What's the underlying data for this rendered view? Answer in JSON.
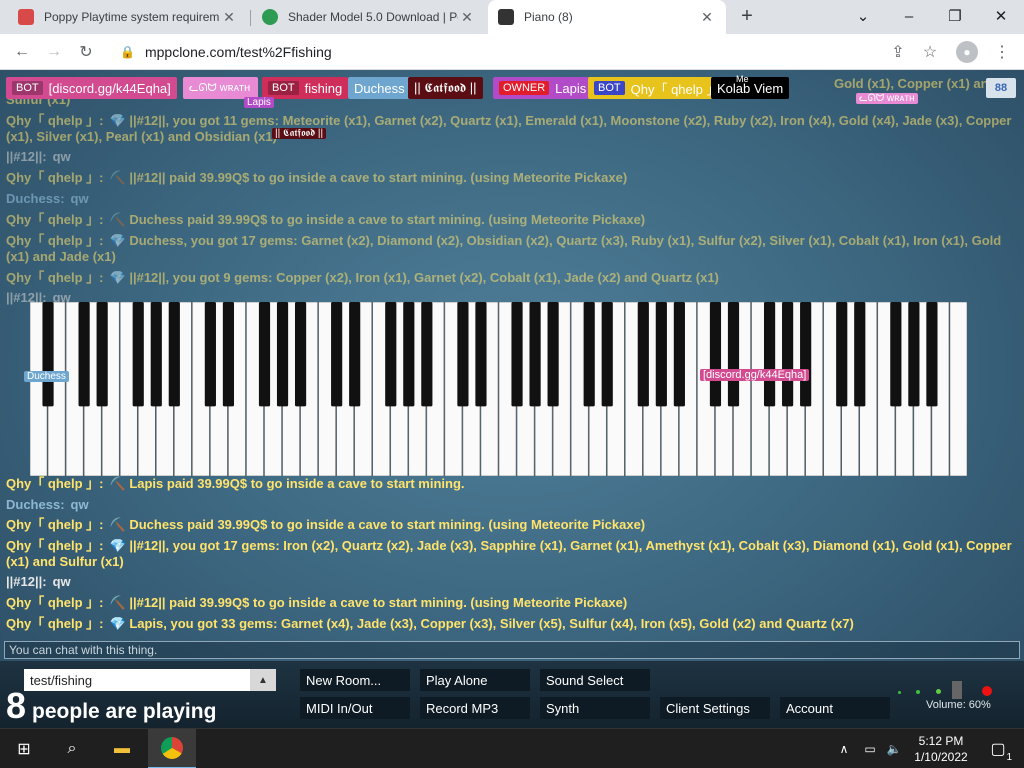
{
  "browser": {
    "tabs": [
      {
        "title": "Poppy Playtime system requirem",
        "icon": "poppy-favicon"
      },
      {
        "title": "Shader Model 5.0 Download | Pe",
        "icon": "shader-favicon"
      },
      {
        "title": "Piano (8)",
        "icon": "piano-favicon"
      }
    ],
    "url": "mppclone.com/test%2Ffishing"
  },
  "users": {
    "u1_badge": "BOT",
    "u1_name": "[discord.gg/k44Eqha]",
    "u2_name": "ᓚᘏᗢ ᴡʀᴀᴛʜ",
    "u2_cursor": "Lapis",
    "u3_badge": "BOT",
    "u3_name": "fishing",
    "u4_name": "Duchess",
    "u5_name": "|| 𝕮𝖆𝖙𝖋𝖔𝖔𝖉 ||",
    "u6_badge": "OWNER",
    "u6_name": "Lapis",
    "u7_badge": "BOT",
    "u7_name": "Qhy「 qhelp 」",
    "u8_name": "Kolab Viem",
    "u8_me": "Me",
    "cursor_wrath": "ᓚᘏᗢ ᴡʀᴀᴛʜ",
    "cursor_catfood": "|| 𝕮𝖆𝖙𝖋𝖔𝖔𝖉 ||",
    "cursor_duchess": "Duchess",
    "cursor_discord": "[discord.gg/k44Eqha]",
    "top_right_button": "88"
  },
  "chat": {
    "m0_text": "Gold (x1), Copper (x1) and",
    "m0b_text": "Sulfur (x1)",
    "m1_who": "Qhy「 qhelp 」:",
    "m1_text": "💎 ||#12||, you got 11 gems: Meteorite (x1), Garnet (x2), Quartz (x1), Emerald (x1), Moonstone (x2), Ruby (x2), Iron (x4), Gold (x4), Jade (x3), Copper (x1), Silver (x1), Pearl (x1) and Obsidian (x1)",
    "m2_who": "||#12||:",
    "m2_text": "qw",
    "m3_who": "Qhy「 qhelp 」:",
    "m3_text": "⛏️ ||#12|| paid 39.99Q$ to go inside a cave to start mining. (using Meteorite Pickaxe)",
    "m4_who": "Duchess:",
    "m4_text": "qw",
    "m5_who": "Qhy「 qhelp 」:",
    "m5_text": "⛏️ Duchess paid 39.99Q$ to go inside a cave to start mining. (using Meteorite Pickaxe)",
    "m6_who": "Qhy「 qhelp 」:",
    "m6_text": "💎 Duchess, you got 17 gems: Garnet (x2), Diamond (x2), Obsidian (x2), Quartz (x3), Ruby (x1), Sulfur (x2), Silver (x1), Cobalt (x1), Iron (x1), Gold (x1) and Jade (x1)",
    "m7_who": "Qhy「 qhelp 」:",
    "m7_text": "💎 ||#12||, you got 9 gems: Copper (x2), Iron (x1), Garnet (x2), Cobalt (x1), Jade (x2) and Quartz (x1)",
    "m8_who": "||#12||:",
    "m8_text": "qw",
    "m9_who": "Qhy「 qhelp 」:",
    "m9_text": "⛏️ Lapis paid 39.99Q$ to go inside a cave to start mining.",
    "m10_who": "Duchess:",
    "m10_text": "qw",
    "m11_who": "Qhy「 qhelp 」:",
    "m11_text": "⛏️ Duchess paid 39.99Q$ to go inside a cave to start mining. (using Meteorite Pickaxe)",
    "m12_who": "Qhy「 qhelp 」:",
    "m12_text": "💎 ||#12||, you got 17 gems: Iron (x2), Quartz (x2), Jade (x3), Sapphire (x1), Garnet (x1), Amethyst (x1), Cobalt (x3), Diamond (x1), Gold (x1), Copper (x1) and Sulfur (x1)",
    "m13_who": "||#12||:",
    "m13_text": "qw",
    "m14_who": "Qhy「 qhelp 」:",
    "m14_text": "⛏️ ||#12|| paid 39.99Q$ to go inside a cave to start mining. (using Meteorite Pickaxe)",
    "m15_who": "Qhy「 qhelp 」:",
    "m15_text": "💎 Lapis, you got 33 gems: Garnet (x4), Jade (x3), Copper (x3), Silver (x5), Sulfur (x4), Iron (x5), Gold (x2) and Quartz (x7)",
    "input_placeholder": "You can chat with this thing."
  },
  "controls": {
    "room": "test/fishing",
    "new_room": "New Room...",
    "play_alone": "Play Alone",
    "sound_select": "Sound Select",
    "midi": "MIDI In/Out",
    "record": "Record MP3",
    "synth": "Synth",
    "client_settings": "Client Settings",
    "account": "Account",
    "people_count": "8",
    "people_text": "people are playing",
    "volume": "Volume: 60%"
  },
  "taskbar": {
    "time": "5:12 PM",
    "date": "1/10/2022",
    "notif_count": "1"
  },
  "colors": {
    "bot_discord": "#d24a8f",
    "wrath": "#e88ad4",
    "fishing": "#cf2d5a",
    "duchess": "#6ea6cf",
    "catfood": "#5a0d12",
    "lapis": "#b24bc7",
    "qhy": "#e7c31b",
    "kolab": "#000000",
    "chat_gold": "#ffe36b"
  }
}
